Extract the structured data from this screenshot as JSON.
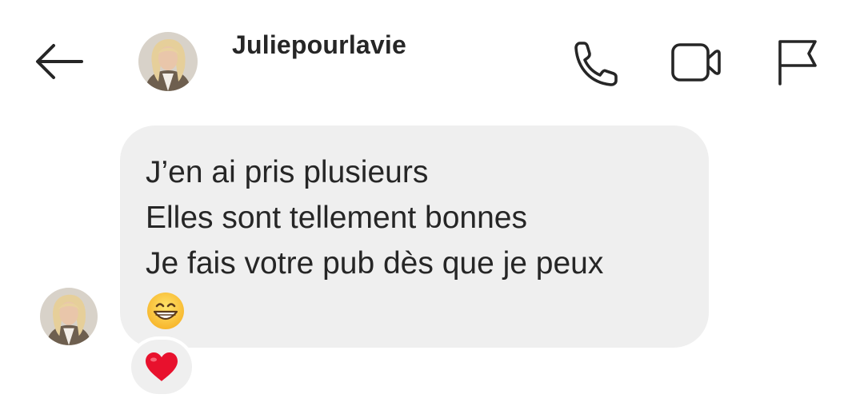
{
  "header": {
    "username": "Juliepourlavie",
    "back_icon": "arrow-left-icon",
    "call_icon": "phone-icon",
    "video_icon": "video-camera-icon",
    "report_icon": "flag-icon"
  },
  "message": {
    "lines": [
      "J’en ai pris plusieurs",
      "Elles sont tellement bonnes",
      "Je fais votre pub dès que je peux"
    ],
    "emoji": "grinning-face-icon",
    "reaction": "red-heart-icon"
  },
  "colors": {
    "bubble": "#efefef",
    "text": "#262626",
    "heart": "#e8112d"
  }
}
